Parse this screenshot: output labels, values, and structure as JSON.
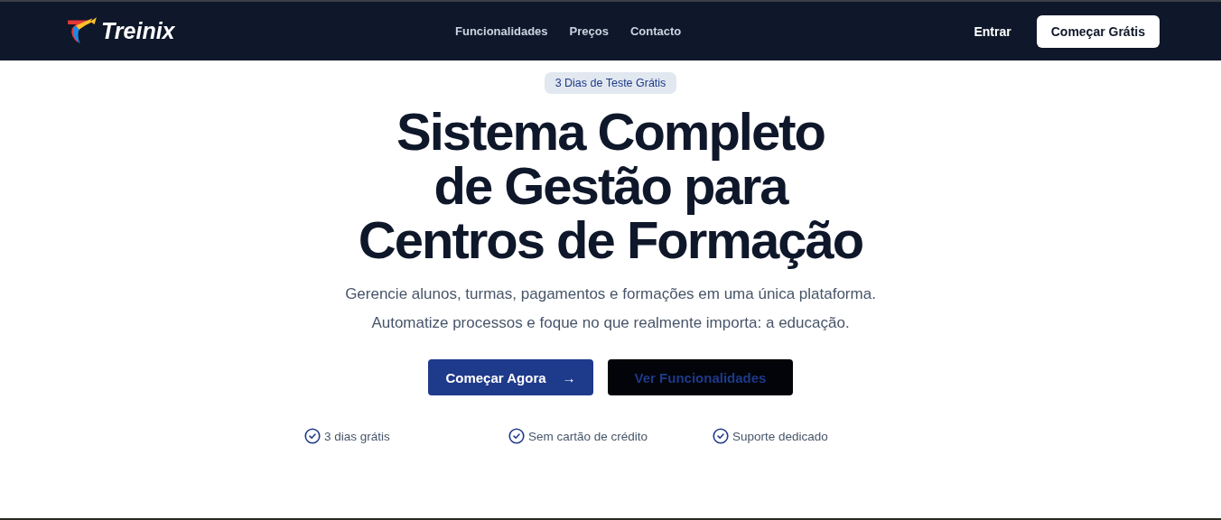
{
  "nav": {
    "brand": "Treinix",
    "links": [
      "Funcionalidades",
      "Preços",
      "Contacto"
    ],
    "login": "Entrar",
    "cta": "Começar Grátis"
  },
  "hero": {
    "badge": "3 Dias de Teste Grátis",
    "title_lines": [
      "Sistema Completo",
      "de Gestão para",
      "Centros de Formação"
    ],
    "subtitle": "Gerencie alunos, turmas, pagamentos e formações em uma única plataforma. Automatize processos e foque no que realmente importa: a educação.",
    "primary_button": "Começar Agora",
    "arrow": "→",
    "secondary_button": "Ver Funcionalidades",
    "features": [
      "3 dias grátis",
      "Sem cartão de crédito",
      "Suporte dedicado"
    ]
  }
}
